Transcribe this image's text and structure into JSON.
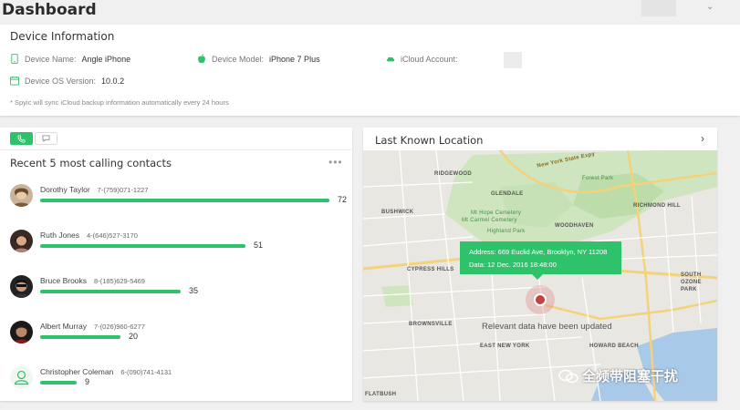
{
  "header": {
    "title": "Dashboard"
  },
  "device": {
    "title": "Device Information",
    "name_label": "Device Name:",
    "name_value": "Angle iPhone",
    "model_label": "Device Model:",
    "model_value": "iPhone 7 Plus",
    "icloud_label": "iCloud Account:",
    "os_label": "Device OS Version:",
    "os_value": "10.0.2",
    "footnote": "* Spyic will sync iCloud backup information automatically every 24 hours"
  },
  "contacts": {
    "title": "Recent 5 most calling contacts",
    "more": "•••",
    "items": [
      {
        "name": "Dorothy Taylor",
        "phone": "7-(759)071-1227",
        "count": "72",
        "value": 72
      },
      {
        "name": "Ruth Jones",
        "phone": "4-(646)527-3170",
        "count": "51",
        "value": 51
      },
      {
        "name": "Bruce Brooks",
        "phone": "8-(185)629-5469",
        "count": "35",
        "value": 35
      },
      {
        "name": "Albert Murray",
        "phone": "7-(026)960-6277",
        "count": "20",
        "value": 20
      },
      {
        "name": "Christopher Coleman",
        "phone": "6-(090)741-4131",
        "count": "9",
        "value": 9
      }
    ]
  },
  "location": {
    "title": "Last Known Location",
    "address": "Address: 669 Euclid Ave, Brooklyn, NY 11208",
    "date": "Data: 12 Dec. 2016  18:48:00",
    "status": "Relevant data have been updated",
    "map_labels": {
      "ridgewood": "RIDGEWOOD",
      "glendale": "GLENDALE",
      "cemetery": "Mt Hope Cemetery",
      "carmel": "Mt Carmel Cemetery",
      "bushwick": "BUSHWICK",
      "woodhaven": "WOODHAVEN",
      "richmond": "RICHMOND HILL",
      "highland": "Highland Park",
      "cypress": "CYPRESS HILLS",
      "south_ozone": "SOUTH OZONE PARK",
      "brownsville": "BROWNSVILLE",
      "east_ny": "EAST NEW YORK",
      "howard": "HOWARD BEACH",
      "flatbush": "FLATBUSH",
      "park": "Forest Park",
      "expressway": "New York State Expy"
    }
  },
  "watermark": {
    "text": "全频带阻塞干扰"
  },
  "colors": {
    "accent": "#2ec26a",
    "pin": "#c94040"
  }
}
